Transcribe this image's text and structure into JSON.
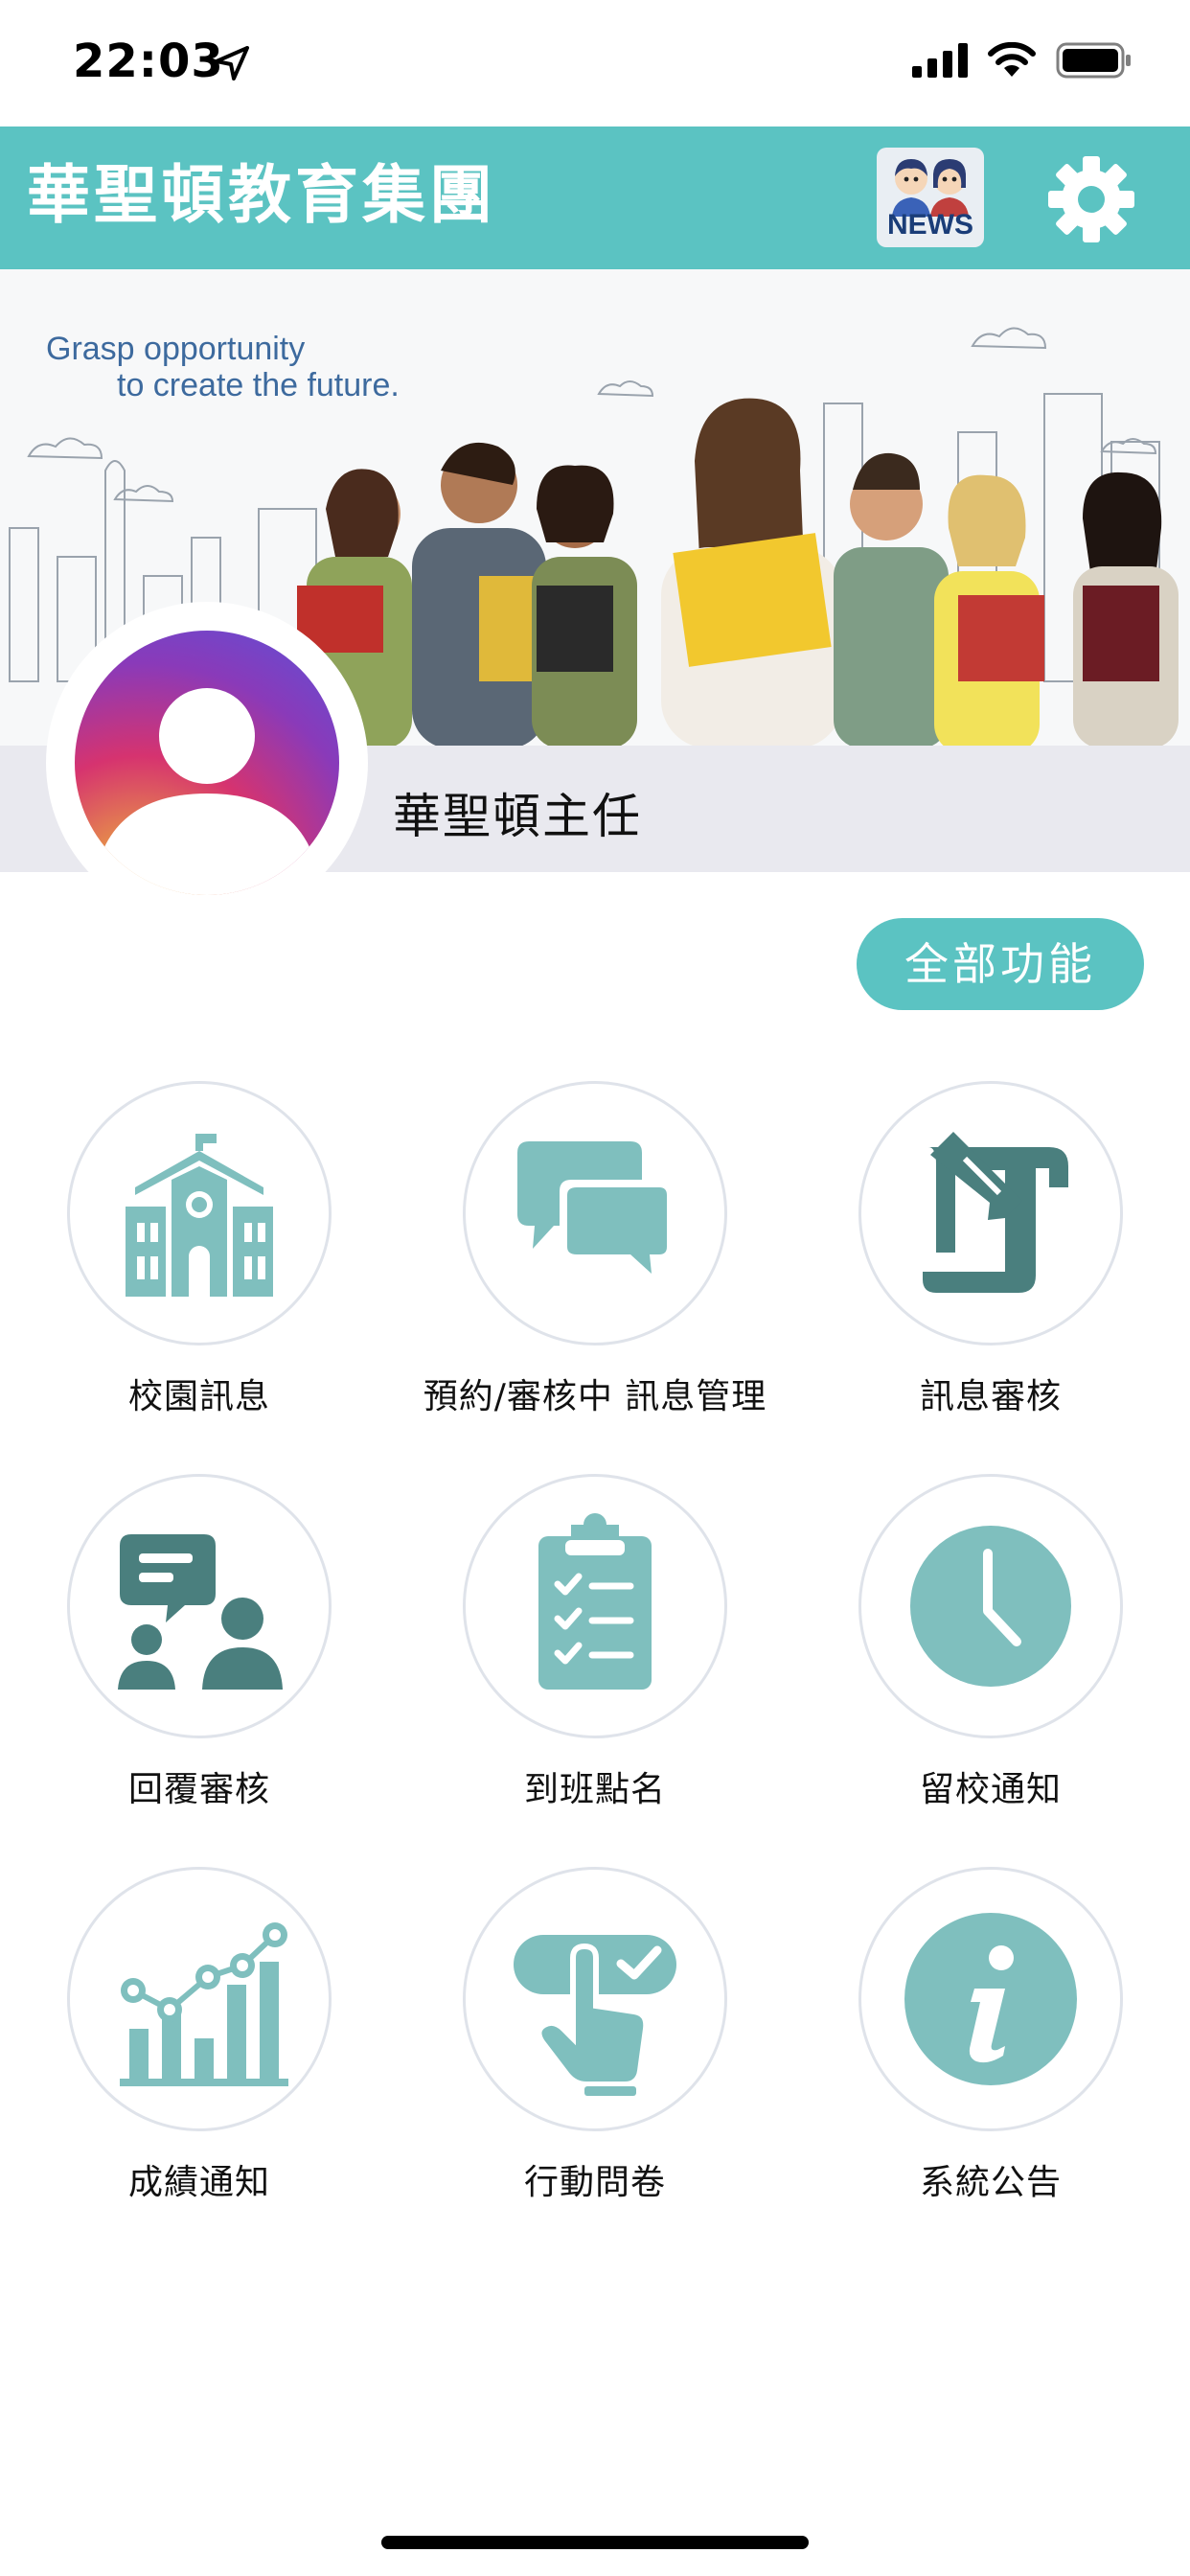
{
  "status_bar": {
    "time": "22:03"
  },
  "header": {
    "title": "華聖頓教育集團",
    "news_label": "NEWS"
  },
  "banner": {
    "tagline_line1": "Grasp opportunity",
    "tagline_line2": "to create the future."
  },
  "profile": {
    "name": "華聖頓主任"
  },
  "all_functions_label": "全部功能",
  "colors": {
    "brand": "#5bc3c2",
    "icon_teal": "#7fbfbe",
    "icon_dark": "#4a7f7e"
  },
  "features": [
    {
      "label": "校園訊息",
      "icon": "school-icon"
    },
    {
      "label": "預約/審核中 訊息管理",
      "icon": "chat-bubbles-icon"
    },
    {
      "label": "訊息審核",
      "icon": "edit-document-icon"
    },
    {
      "label": "回覆審核",
      "icon": "reply-review-icon"
    },
    {
      "label": "到班點名",
      "icon": "clipboard-checklist-icon"
    },
    {
      "label": "留校通知",
      "icon": "clock-icon"
    },
    {
      "label": "成績通知",
      "icon": "chart-icon"
    },
    {
      "label": "行動問卷",
      "icon": "touch-check-icon"
    },
    {
      "label": "系統公告",
      "icon": "info-icon"
    }
  ]
}
